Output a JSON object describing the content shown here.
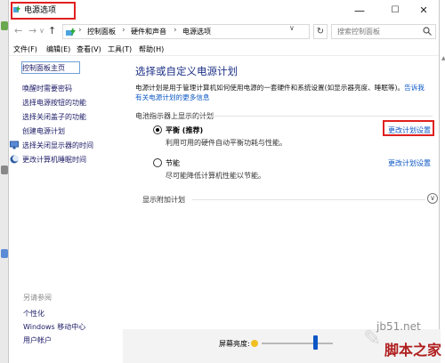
{
  "window": {
    "title": "电源选项",
    "controls": {
      "minimize": "—",
      "maximize": "☐",
      "close": "✕"
    }
  },
  "address": {
    "back": "←",
    "forward": "→",
    "up": "↑",
    "crumbs": [
      "控制面板",
      "硬件和声音",
      "电源选项"
    ],
    "separator": "›",
    "dropdown": "∨",
    "refresh": "↻",
    "search_placeholder": "搜索控制面板"
  },
  "menu": [
    "文件(F)",
    "编辑(E)",
    "查看(V)",
    "工具(T)",
    "帮助(H)"
  ],
  "sidebar": {
    "home": "控制面板主页",
    "items": [
      "唤醒时需要密码",
      "选择电源按钮的功能",
      "选择关闭盖子的功能",
      "创建电源计划",
      "选择关闭显示器的时间",
      "更改计算机睡眠时间"
    ],
    "see_also": "另请参阅",
    "bottom": [
      "个性化",
      "Windows 移动中心",
      "用户帐户"
    ]
  },
  "main": {
    "title": "选择或自定义电源计划",
    "description": "电源计划是用于管理计算机如何使用电源的一套硬件和系统设置(如显示器亮度、睡眠等)。",
    "link1": "告诉我",
    "link2": "有关电源计划的更多信息",
    "group_label": "电池指示器上显示的计划",
    "plans": [
      {
        "name": "平衡 (推荐)",
        "desc": "利用可用的硬件自动平衡功耗与性能。",
        "link": "更改计划设置",
        "selected": true
      },
      {
        "name": "节能",
        "desc": "尽可能降低计算机性能以节能。",
        "link": "更改计划设置",
        "selected": false
      }
    ],
    "show_more": "显示附加计划",
    "expand": "∨"
  },
  "status": {
    "brightness_label": "屏幕亮度:",
    "brightness": 0.75
  },
  "watermark": {
    "site": "jb51.net",
    "name": "脚本之家"
  },
  "colors": {
    "accent": "#0b57c5",
    "highlight_box": "#e02020",
    "title_blue": "#1e3287"
  }
}
